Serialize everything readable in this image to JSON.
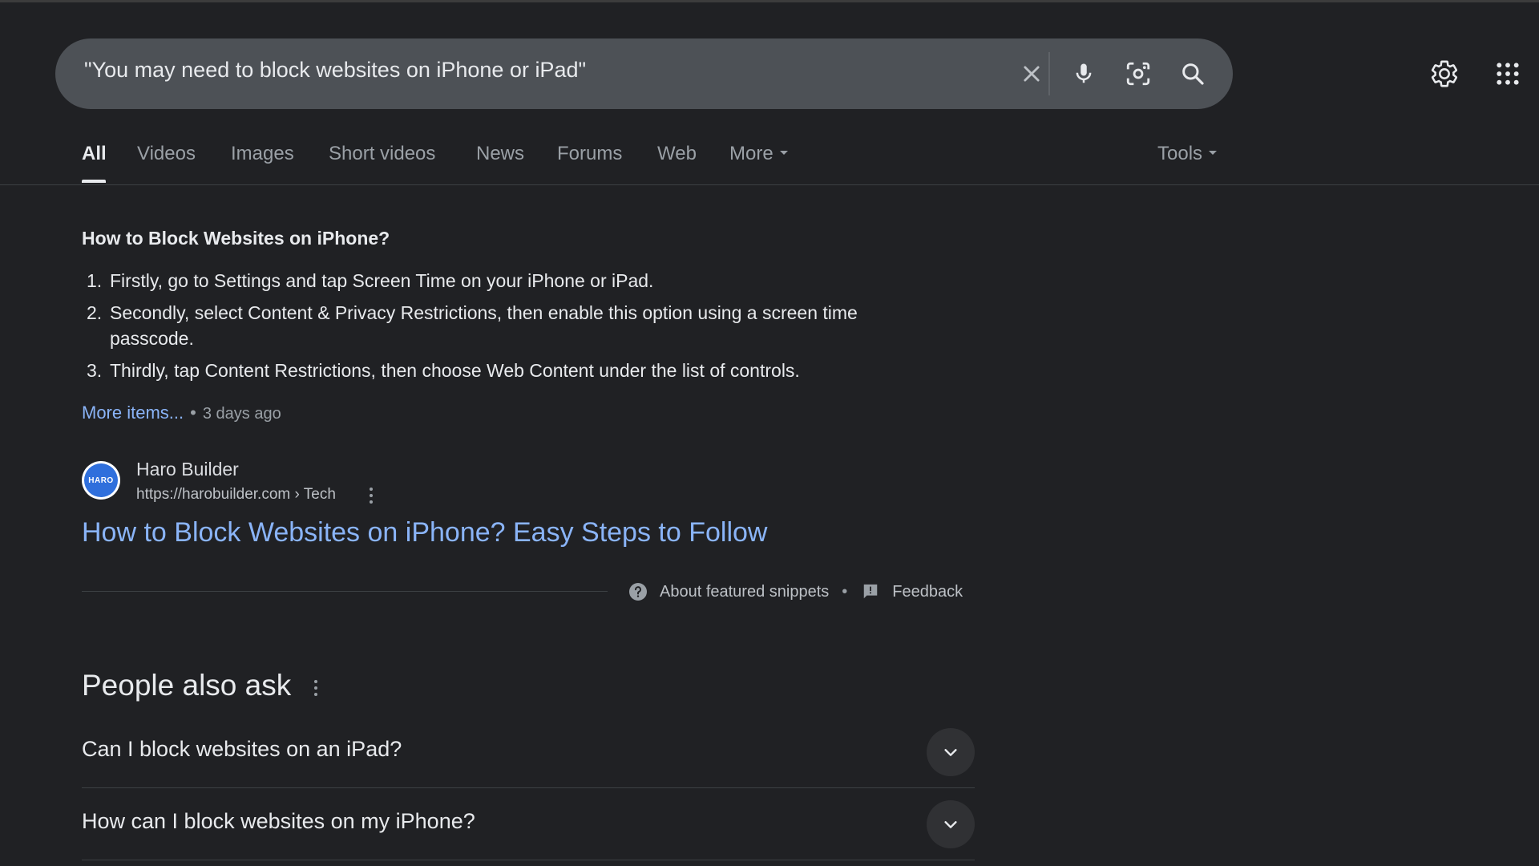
{
  "search": {
    "query": "\"You may need to block websites on iPhone or iPad\""
  },
  "icons": {
    "clear": "close-icon",
    "voice": "microphone-icon",
    "lens": "camera-lens-icon",
    "search": "search-icon",
    "settings": "gear-icon",
    "apps": "apps-grid-icon"
  },
  "tabs": [
    {
      "label": "All",
      "active": true
    },
    {
      "label": "Videos"
    },
    {
      "label": "Images"
    },
    {
      "label": "Short videos"
    },
    {
      "label": "News"
    },
    {
      "label": "Forums"
    },
    {
      "label": "Web"
    },
    {
      "label": "More"
    }
  ],
  "tools_label": "Tools",
  "snippet": {
    "title": "How to Block Websites on iPhone?",
    "steps": [
      {
        "num": "1.",
        "text": "Firstly, go to Settings and tap Screen Time on your iPhone or iPad."
      },
      {
        "num": "2.",
        "text": "Secondly, select Content & Privacy Restrictions, then enable this option using a screen time passcode."
      },
      {
        "num": "3.",
        "text": "Thirdly, tap Content Restrictions, then choose Web Content under the list of controls."
      }
    ],
    "more_items": "More items...",
    "separator": "•",
    "date": "3 days ago",
    "source": {
      "favicon_text": "HARO",
      "name": "Haro Builder",
      "url": "https://harobuilder.com › Tech"
    },
    "result_title": "How to Block Websites on iPhone? Easy Steps to Follow",
    "about": "About featured snippets",
    "feedback": "Feedback"
  },
  "people_also_ask": {
    "title": "People also ask",
    "questions": [
      "Can I block websites on an iPad?",
      "How can I block websites on my iPhone?"
    ]
  },
  "colors": {
    "background": "#202124",
    "link": "#8ab4f8",
    "text": "#e8eaed",
    "muted": "#9aa0a6"
  }
}
